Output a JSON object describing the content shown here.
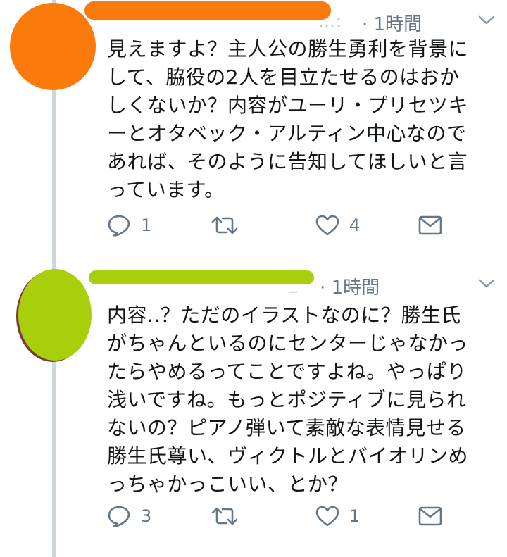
{
  "colors": {
    "thread_line": "#ccd6dd",
    "text": "#14171a",
    "secondary": "#657786",
    "avatar_1_scribble": "#fb7a0c",
    "avatar_2_scribble": "#a7cf0b"
  },
  "tweets": [
    {
      "handle_residue": "…:",
      "time": "· 1時間",
      "body_lines": [
        "見えますよ？主人公の勝生勇利を背景に",
        "して、脇役の2人を目立たせるのはおか",
        "しくないか？内容がユーリ・プリセツキ",
        "ーとオタベック・アルティン中心なので",
        "あれば、そのように告知してほしいと言",
        "っています。"
      ],
      "actions": {
        "reply_icon": "reply-icon",
        "reply_count": "1",
        "retweet_icon": "retweet-icon",
        "retweet_count": "",
        "like_icon": "heart-icon",
        "like_count": "4",
        "dm_icon": "envelope-icon"
      }
    },
    {
      "handle_residue": "_",
      "time": "· 1時間",
      "body_lines": [
        "内容..？ただのイラストなのに？勝生氏",
        "がちゃんといるのにセンターじゃなかっ",
        "たらやめるってことですよね。やっぱり",
        "浅いですね。もっとポジティブに見られ",
        "ないの？ピアノ弾いて素敵な表情見せる",
        "勝生氏尊い、ヴィクトルとバイオリンめ",
        "っちゃかっこいい、とか？"
      ],
      "actions": {
        "reply_icon": "reply-icon",
        "reply_count": "3",
        "retweet_icon": "retweet-icon",
        "retweet_count": "",
        "like_icon": "heart-icon",
        "like_count": "1",
        "dm_icon": "envelope-icon"
      }
    }
  ]
}
